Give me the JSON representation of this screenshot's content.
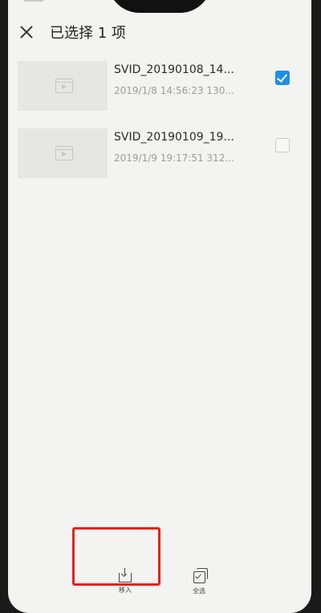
{
  "header": {
    "title": "已选择 1 项"
  },
  "files": [
    {
      "name": "SVID_20190108_14...",
      "meta": "2019/1/8 14:56:23 130...",
      "checked": true
    },
    {
      "name": "SVID_20190109_19...",
      "meta": "2019/1/9 19:17:51 312...",
      "checked": false
    }
  ],
  "bottom_bar": {
    "move_label": "移入",
    "select_all_label": "全选"
  },
  "colors": {
    "accent": "#1e8fe6",
    "highlight": "#e5211d"
  },
  "icons": [
    "close-icon",
    "video-icon",
    "move-in-icon",
    "select-all-icon",
    "check-icon"
  ]
}
